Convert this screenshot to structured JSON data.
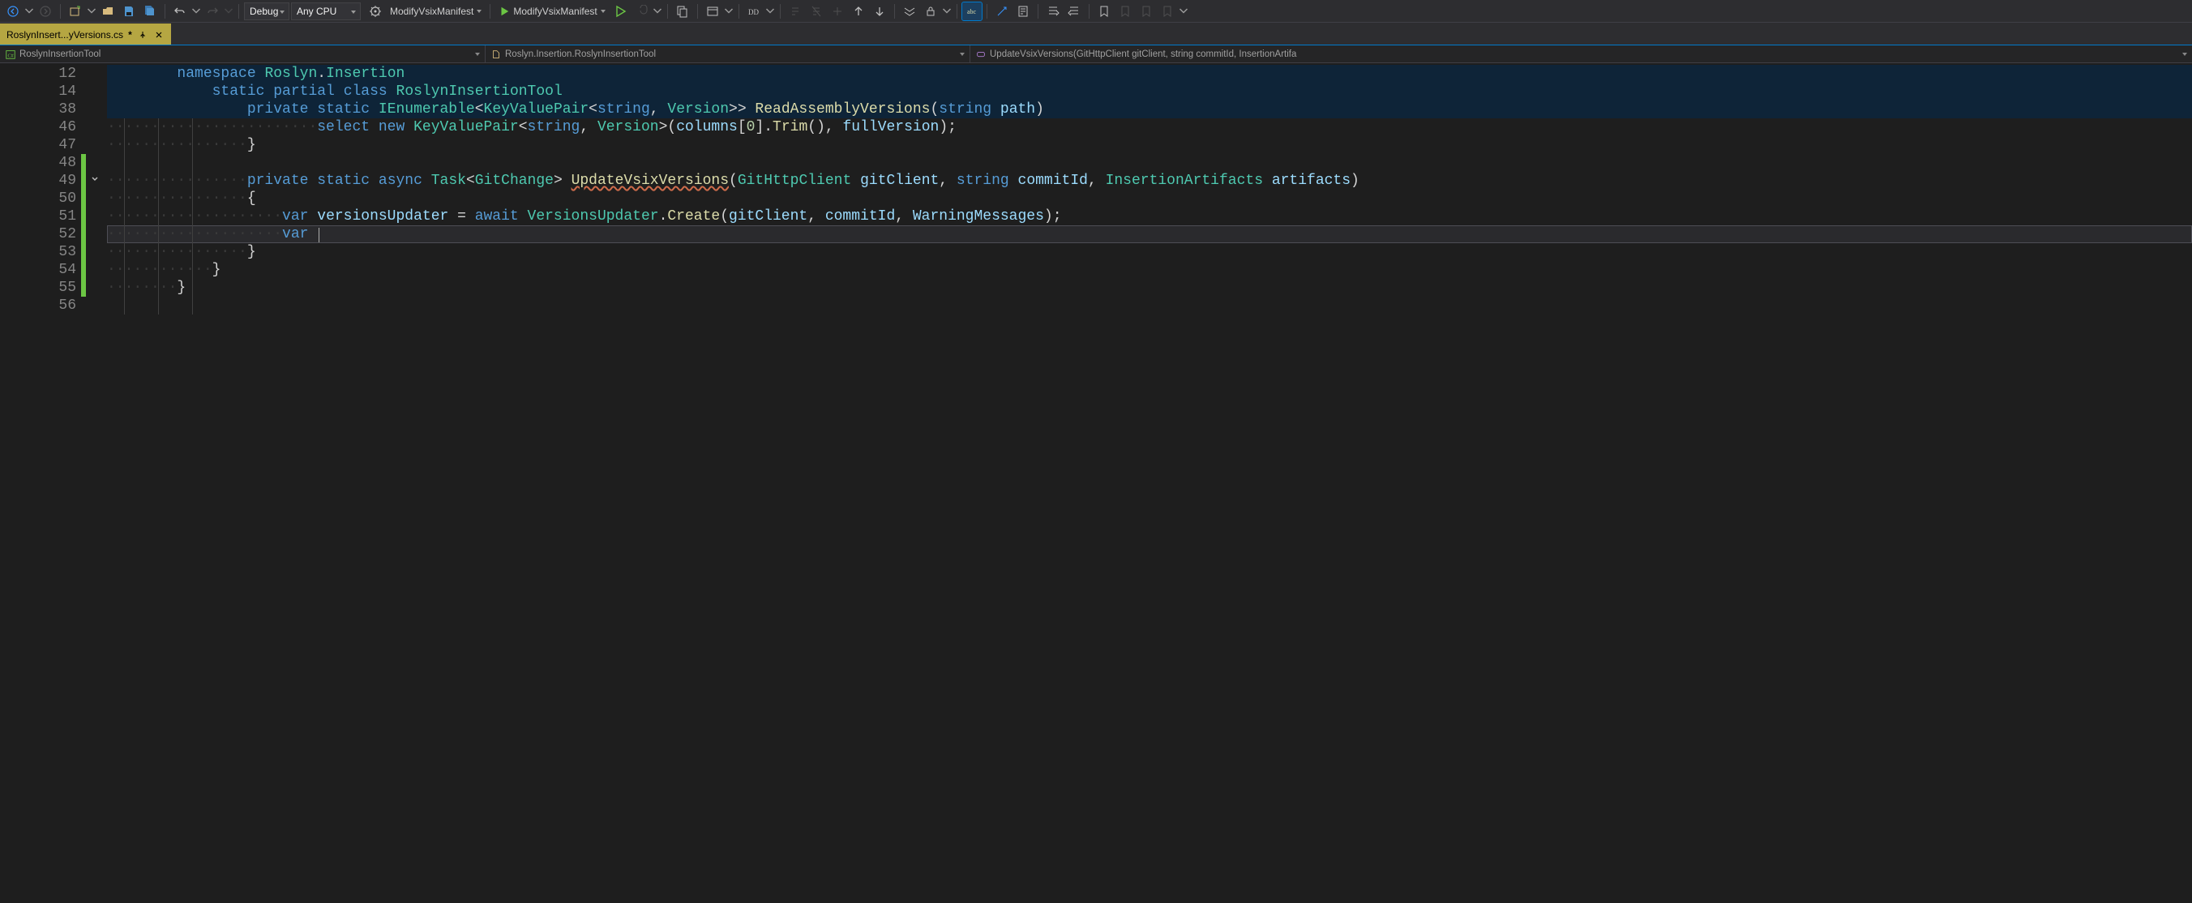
{
  "toolbar": {
    "configuration": "Debug",
    "platform": "Any CPU",
    "startup_a": "ModifyVsixManifest",
    "startup_b": "ModifyVsixManifest"
  },
  "tab": {
    "title": "RoslynInsert...yVersions.cs",
    "dirty": "*"
  },
  "nav": {
    "project": "RoslynInsertionTool",
    "type": "Roslyn.Insertion.RoslynInsertionTool",
    "member": "UpdateVsixVersions(GitHttpClient gitClient, string commitId, InsertionArtifa"
  },
  "lines": [
    {
      "n": "12",
      "context": true,
      "tokens": [
        [
          "dots",
          "        "
        ],
        [
          "kw",
          "namespace"
        ],
        [
          "punct",
          " "
        ],
        [
          "type",
          "Roslyn"
        ],
        [
          "punct",
          "."
        ],
        [
          "type",
          "Insertion"
        ]
      ]
    },
    {
      "n": "14",
      "context": true,
      "tokens": [
        [
          "dots",
          "            "
        ],
        [
          "kw",
          "static"
        ],
        [
          "punct",
          " "
        ],
        [
          "kw",
          "partial"
        ],
        [
          "punct",
          " "
        ],
        [
          "kw",
          "class"
        ],
        [
          "punct",
          " "
        ],
        [
          "type",
          "RoslynInsertionTool"
        ]
      ]
    },
    {
      "n": "38",
      "context": true,
      "tokens": [
        [
          "dots",
          "                "
        ],
        [
          "kw",
          "private"
        ],
        [
          "punct",
          " "
        ],
        [
          "kw",
          "static"
        ],
        [
          "punct",
          " "
        ],
        [
          "type",
          "IEnumerable"
        ],
        [
          "punct",
          "<"
        ],
        [
          "type",
          "KeyValuePair"
        ],
        [
          "punct",
          "<"
        ],
        [
          "kw",
          "string"
        ],
        [
          "punct",
          ", "
        ],
        [
          "type",
          "Version"
        ],
        [
          "punct",
          ">> "
        ],
        [
          "method",
          "ReadAssemblyVersions"
        ],
        [
          "punct",
          "("
        ],
        [
          "kw",
          "string"
        ],
        [
          "punct",
          " "
        ],
        [
          "local",
          "path"
        ],
        [
          "punct",
          ")"
        ]
      ]
    },
    {
      "n": "46",
      "tokens": [
        [
          "dots",
          "························"
        ],
        [
          "kw",
          "select"
        ],
        [
          "punct",
          " "
        ],
        [
          "kw",
          "new"
        ],
        [
          "punct",
          " "
        ],
        [
          "type",
          "KeyValuePair"
        ],
        [
          "punct",
          "<"
        ],
        [
          "kw",
          "string"
        ],
        [
          "punct",
          ", "
        ],
        [
          "type",
          "Version"
        ],
        [
          "punct",
          ">("
        ],
        [
          "local",
          "columns"
        ],
        [
          "punct",
          "["
        ],
        [
          "num",
          "0"
        ],
        [
          "punct",
          "]."
        ],
        [
          "method",
          "Trim"
        ],
        [
          "punct",
          "(), "
        ],
        [
          "local",
          "fullVersion"
        ],
        [
          "punct",
          ");"
        ]
      ]
    },
    {
      "n": "47",
      "tokens": [
        [
          "dots",
          "················"
        ],
        [
          "punct",
          "}"
        ]
      ]
    },
    {
      "n": "48",
      "tokens": [
        [
          "dots",
          ""
        ]
      ]
    },
    {
      "n": "49",
      "tokens": [
        [
          "dots",
          "················"
        ],
        [
          "kw",
          "private"
        ],
        [
          "punct",
          " "
        ],
        [
          "kw",
          "static"
        ],
        [
          "punct",
          " "
        ],
        [
          "kw",
          "async"
        ],
        [
          "punct",
          " "
        ],
        [
          "type",
          "Task"
        ],
        [
          "punct",
          "<"
        ],
        [
          "type",
          "GitChange"
        ],
        [
          "punct",
          "> "
        ],
        [
          "method wavy",
          "UpdateVsixVersions"
        ],
        [
          "punct",
          "("
        ],
        [
          "type",
          "GitHttpClient"
        ],
        [
          "punct",
          " "
        ],
        [
          "local",
          "gitClient"
        ],
        [
          "punct",
          ", "
        ],
        [
          "kw",
          "string"
        ],
        [
          "punct",
          " "
        ],
        [
          "local",
          "commitId"
        ],
        [
          "punct",
          ", "
        ],
        [
          "type",
          "InsertionArtifacts"
        ],
        [
          "punct",
          " "
        ],
        [
          "local",
          "artifacts"
        ],
        [
          "punct",
          ")"
        ]
      ]
    },
    {
      "n": "50",
      "tokens": [
        [
          "dots",
          "················"
        ],
        [
          "punct",
          "{"
        ]
      ]
    },
    {
      "n": "51",
      "tokens": [
        [
          "dots",
          "····················"
        ],
        [
          "kw",
          "var"
        ],
        [
          "punct",
          " "
        ],
        [
          "local",
          "versionsUpdater"
        ],
        [
          "punct",
          " = "
        ],
        [
          "kw",
          "await"
        ],
        [
          "punct",
          " "
        ],
        [
          "type",
          "VersionsUpdater"
        ],
        [
          "punct",
          "."
        ],
        [
          "method",
          "Create"
        ],
        [
          "punct",
          "("
        ],
        [
          "local",
          "gitClient"
        ],
        [
          "punct",
          ", "
        ],
        [
          "local",
          "commitId"
        ],
        [
          "punct",
          ", "
        ],
        [
          "local",
          "WarningMessages"
        ],
        [
          "punct",
          ");"
        ]
      ]
    },
    {
      "n": "52",
      "current": true,
      "tokens": [
        [
          "dots",
          "····················"
        ],
        [
          "kw",
          "var"
        ],
        [
          "punct",
          " "
        ]
      ]
    },
    {
      "n": "53",
      "tokens": [
        [
          "dots",
          "················"
        ],
        [
          "punct",
          "}"
        ]
      ]
    },
    {
      "n": "54",
      "tokens": [
        [
          "dots",
          "············"
        ],
        [
          "punct",
          "}"
        ]
      ]
    },
    {
      "n": "55",
      "tokens": [
        [
          "dots",
          "········"
        ],
        [
          "punct",
          "}"
        ]
      ]
    },
    {
      "n": "56",
      "tokens": [
        [
          "dots",
          ""
        ]
      ]
    }
  ],
  "fold_chevron_row": 6,
  "changebar": {
    "from_row": 5,
    "to_row": 12
  },
  "colors": {
    "background": "#1e1e1e",
    "active_tab": "#b5a642",
    "context_row": "#0e2438",
    "keyword": "#569cd6",
    "type": "#4ec9b0",
    "method": "#dcdcaa",
    "local": "#9cdcfe",
    "number": "#b5cea8",
    "line_number": "#858585"
  }
}
